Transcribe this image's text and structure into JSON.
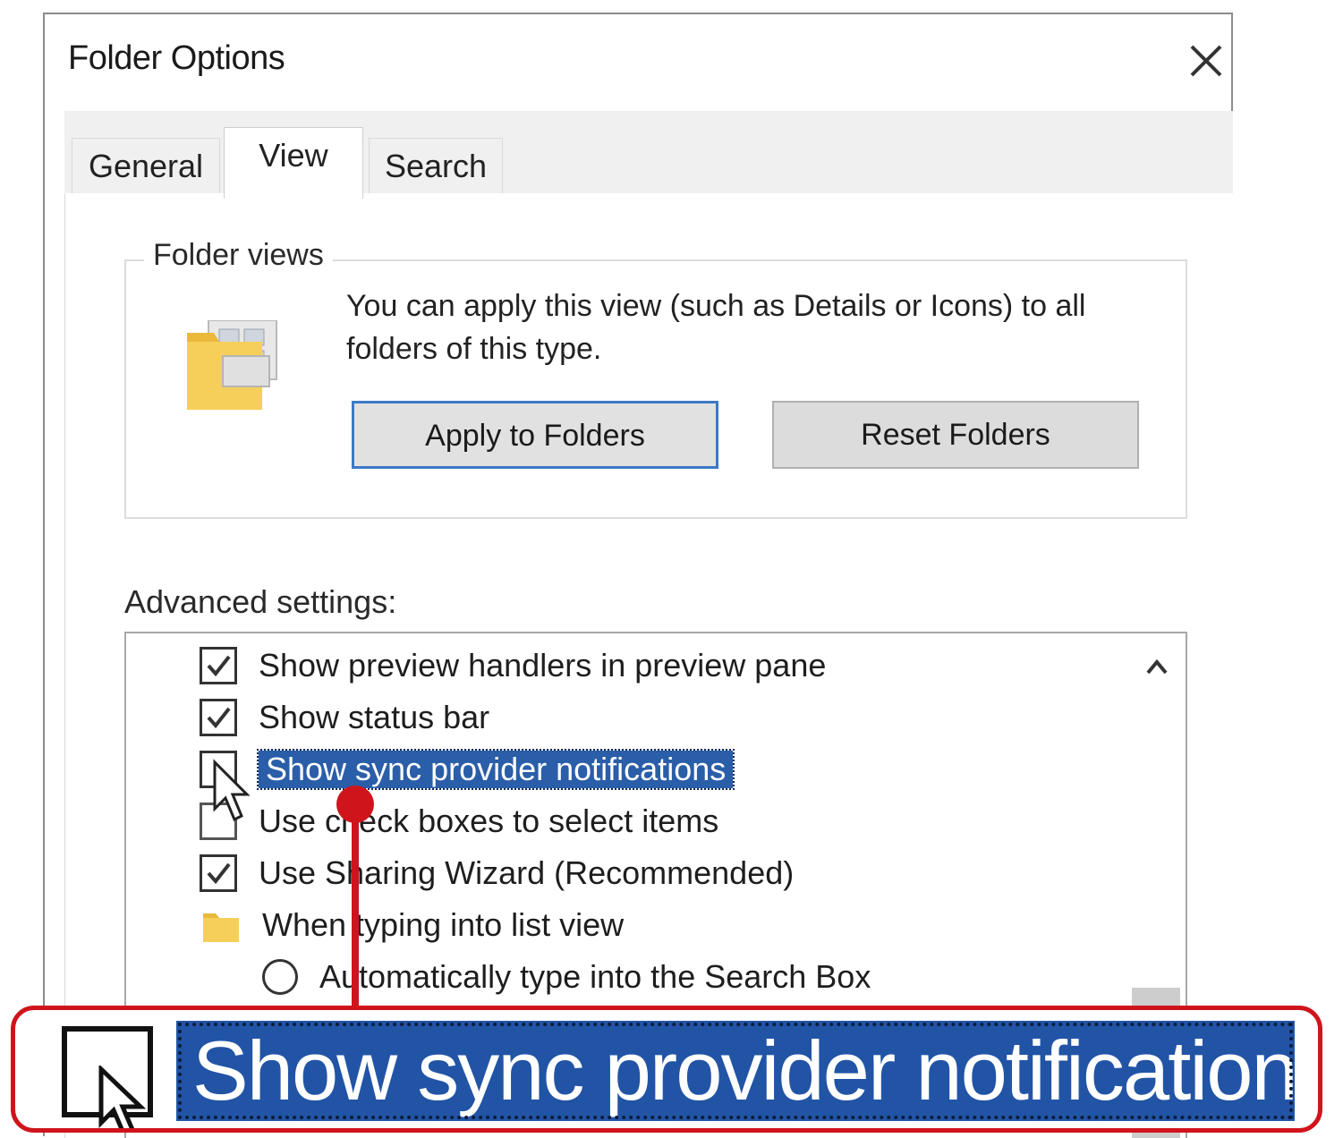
{
  "window": {
    "title": "Folder Options",
    "close_icon": "close-icon"
  },
  "tabs": [
    {
      "label": "General",
      "active": false
    },
    {
      "label": "View",
      "active": true
    },
    {
      "label": "Search",
      "active": false
    }
  ],
  "folder_views": {
    "legend": "Folder views",
    "description": "You can apply this view (such as Details or Icons) to all folders of this type.",
    "apply_button": "Apply to Folders",
    "reset_button": "Reset Folders",
    "icon": "folder-views-icon"
  },
  "advanced": {
    "label": "Advanced settings:",
    "items": [
      {
        "type": "checkbox",
        "label": "Show preview handlers in preview pane",
        "checked": true
      },
      {
        "type": "checkbox",
        "label": "Show status bar",
        "checked": true
      },
      {
        "type": "checkbox",
        "label": "Show sync provider notifications",
        "checked": false,
        "selected": true
      },
      {
        "type": "checkbox",
        "label": "Use check boxes to select items",
        "checked": false
      },
      {
        "type": "checkbox",
        "label": "Use Sharing Wizard (Recommended)",
        "checked": true
      },
      {
        "type": "folder",
        "label": "When typing into list view"
      },
      {
        "type": "radio",
        "label": "Automatically type into the Search Box",
        "checked": false
      }
    ]
  },
  "callout": {
    "label": "Show sync provider notifications",
    "color": "#d0141c",
    "highlight_color": "#2254a6"
  },
  "colors": {
    "selection": "#2a5ea8",
    "accent_button_border": "#3d78c7"
  }
}
